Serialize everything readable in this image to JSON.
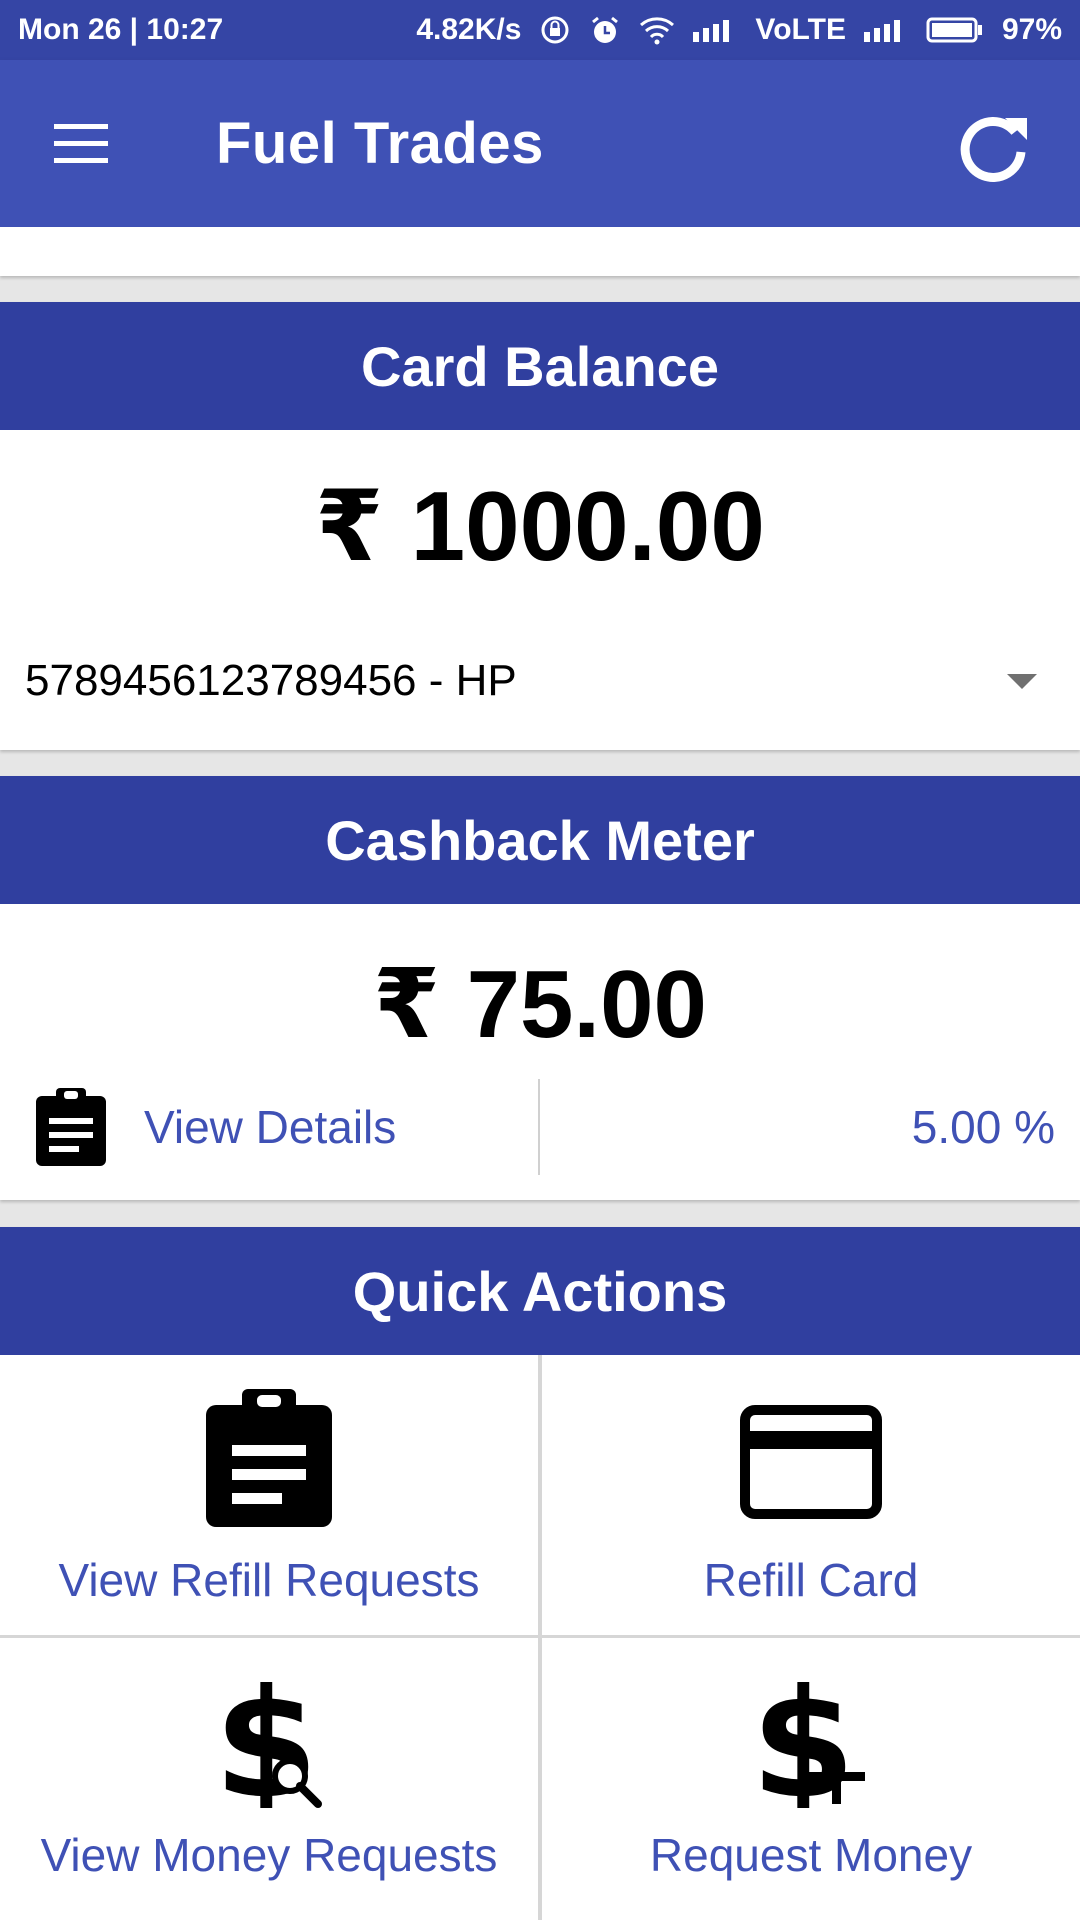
{
  "status_bar": {
    "datetime": "Mon 26 | 10:27",
    "speed": "4.82K/s",
    "network": "VoLTE",
    "battery": "97%"
  },
  "app_bar": {
    "title": "Fuel Trades",
    "menu_icon": "hamburger-menu-icon",
    "refresh_icon": "refresh-icon"
  },
  "card_balance": {
    "header": "Card Balance",
    "amount": "₹ 1000.00",
    "selected_card": "5789456123789456 - HP"
  },
  "cashback_meter": {
    "header": "Cashback Meter",
    "amount": "₹ 75.00",
    "details_label": "View Details",
    "details_icon": "clipboard-icon",
    "percent": "5.00 %"
  },
  "quick_actions": {
    "header": "Quick Actions",
    "items": [
      {
        "label": "View Refill Requests",
        "icon": "clipboard-icon"
      },
      {
        "label": "Refill Card",
        "icon": "credit-card-icon"
      },
      {
        "label": "View Money Requests",
        "icon": "dollar-search-icon"
      },
      {
        "label": "Request Money",
        "icon": "dollar-plus-icon"
      }
    ]
  },
  "colors": {
    "app_bar": "#3f51b5",
    "status_bar": "#3545a5",
    "header": "#303f9f",
    "link": "#3f51b5"
  }
}
